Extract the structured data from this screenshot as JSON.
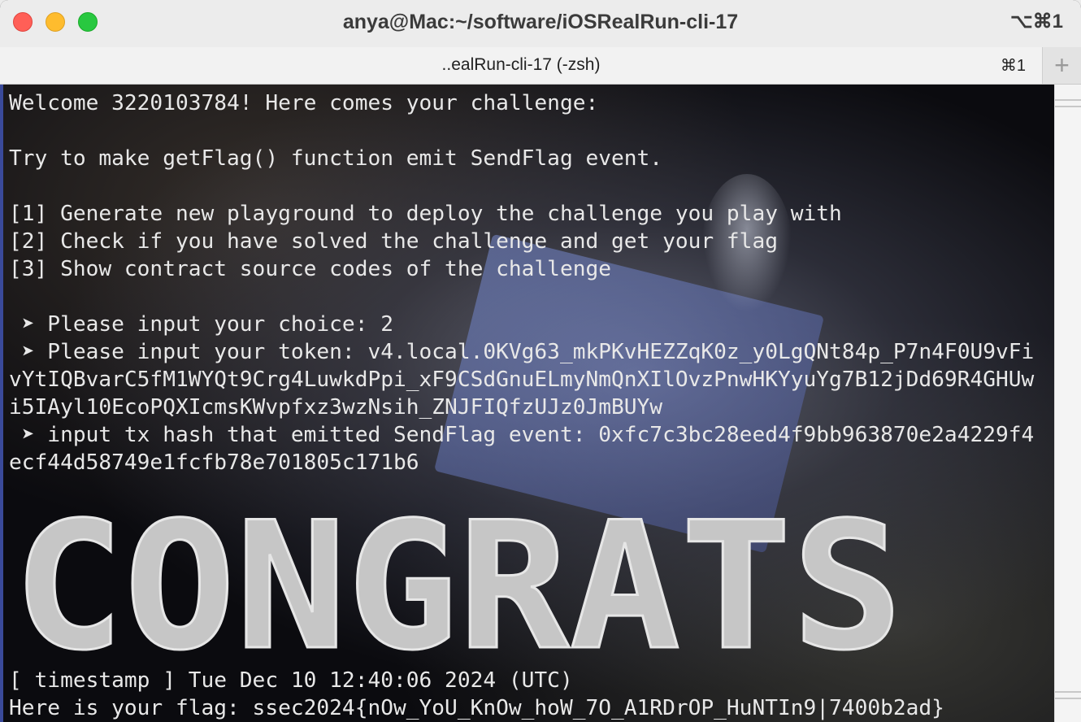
{
  "window": {
    "title": "anya@Mac:~/software/iOSRealRun-cli-17",
    "shortcut": "⌥⌘1"
  },
  "tab": {
    "label": "..ealRun-cli-17 (-zsh)",
    "shortcut": "⌘1",
    "new_tab": "+"
  },
  "terminal": {
    "lines": [
      "Welcome 3220103784! Here comes your challenge:",
      "",
      "Try to make getFlag() function emit SendFlag event.",
      "",
      "[1] Generate new playground to deploy the challenge you play with",
      "[2] Check if you have solved the challenge and get your flag",
      "[3] Show contract source codes of the challenge",
      "",
      " ➤ Please input your choice: 2",
      " ➤ Please input your token: v4.local.0KVg63_mkPKvHEZZqK0z_y0LgQNt84p_P7n4F0U9vFi",
      "vYtIQBvarC5fM1WYQt9Crg4LuwkdPpi_xF9CSdGnuELmyNmQnXIlOvzPnwHKYyuYg7B12jDd69R4GHUw",
      "i5IAyl10EcoPQXIcmsKWvpfxz3wzNsih_ZNJFIQfzUJz0JmBUYw",
      " ➤ input tx hash that emitted SendFlag event: 0xfc7c3bc28eed4f9bb963870e2a4229f4",
      "ecf44d58749e1fcfb78e701805c171b6"
    ],
    "banner": "CONGRATS",
    "timestamp_line": "[ timestamp ] Tue Dec 10 12:40:06 2024 (UTC)",
    "flag_line": "Here is your flag: ssec2024{nOw_YoU_KnOw_hoW_7O_A1RDrOP_HuNTIn9|7400b2ad}"
  }
}
